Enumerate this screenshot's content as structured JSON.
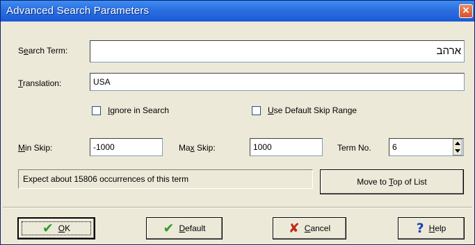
{
  "window": {
    "title": "Advanced Search Parameters",
    "close_glyph": "×"
  },
  "form": {
    "search_term": {
      "label_prefix": "S",
      "label_ul": "e",
      "label_suffix": "arch Term:",
      "value": "ארהב"
    },
    "translation": {
      "label_ul": "T",
      "label_suffix": "ranslation:",
      "value": "USA"
    },
    "ignore_in_search": {
      "label_ul": "I",
      "label_suffix": "gnore in Search",
      "checked": false
    },
    "use_default_skip": {
      "label_ul": "U",
      "label_suffix": "se Default Skip Range",
      "checked": false
    },
    "min_skip": {
      "label_ul": "M",
      "label_suffix": "in Skip:",
      "value": "-1000"
    },
    "max_skip": {
      "label_prefix": "Ma",
      "label_ul": "x",
      "label_suffix": " Skip:",
      "value": "1000"
    },
    "term_no": {
      "label": "Term No.",
      "value": "6"
    }
  },
  "status": {
    "text": "Expect about 15806 occurrences of this term"
  },
  "move_button": {
    "label_prefix": "Move to ",
    "label_ul": "T",
    "label_suffix": "op of List"
  },
  "buttons": {
    "ok": {
      "label_ul": "O",
      "label_suffix": "K",
      "icon": "✔",
      "icon_color": "#2e9c2e"
    },
    "default": {
      "label_ul": "D",
      "label_suffix": "efault",
      "icon": "✔",
      "icon_color": "#2e9c2e"
    },
    "cancel": {
      "label_ul": "C",
      "label_suffix": "ancel",
      "icon": "✘",
      "icon_color": "#c0281c"
    },
    "help": {
      "label_ul": "H",
      "label_suffix": "elp",
      "icon": "?",
      "icon_color": "#1c3fbf"
    }
  }
}
